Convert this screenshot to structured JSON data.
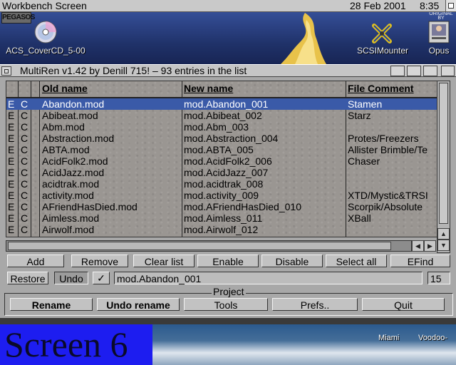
{
  "screen": {
    "title": "Workbench Screen",
    "date": "28 Feb 2001",
    "clock": "8:35"
  },
  "desktop_icons": [
    {
      "label": "ACS_CoverCD_5-00",
      "icon": "cd-disk-icon"
    },
    {
      "label": "SCSIMounter",
      "icon": "tool-icon"
    },
    {
      "label": "Opus",
      "icon": "opus-icon"
    }
  ],
  "logo_text": "PEGASOS",
  "badge_text": "ORIGINAL BY",
  "window": {
    "title": "MultiRen v1.42 by Denill 715! – 93 entries in the list"
  },
  "list": {
    "headers": [
      "Old name",
      "New name",
      "File Comment"
    ],
    "selected_index": 0,
    "rows": [
      {
        "f1": "E",
        "f2": "C",
        "old": "Abandon.mod",
        "new": "mod.Abandon_001",
        "comment": "Stamen"
      },
      {
        "f1": "E",
        "f2": "C",
        "old": "Abibeat.mod",
        "new": "mod.Abibeat_002",
        "comment": "Starz"
      },
      {
        "f1": "E",
        "f2": "C",
        "old": "Abm.mod",
        "new": "mod.Abm_003",
        "comment": ""
      },
      {
        "f1": "E",
        "f2": "C",
        "old": "Abstraction.mod",
        "new": "mod.Abstraction_004",
        "comment": "Protes/Freezers"
      },
      {
        "f1": "E",
        "f2": "C",
        "old": "ABTA.mod",
        "new": "mod.ABTA_005",
        "comment": "Allister Brimble/Te"
      },
      {
        "f1": "E",
        "f2": "C",
        "old": "AcidFolk2.mod",
        "new": "mod.AcidFolk2_006",
        "comment": "Chaser"
      },
      {
        "f1": "E",
        "f2": "C",
        "old": "AcidJazz.mod",
        "new": "mod.AcidJazz_007",
        "comment": ""
      },
      {
        "f1": "E",
        "f2": "C",
        "old": "acidtrak.mod",
        "new": "mod.acidtrak_008",
        "comment": ""
      },
      {
        "f1": "E",
        "f2": "C",
        "old": "activity.mod",
        "new": "mod.activity_009",
        "comment": "XTD/Mystic&TRSI"
      },
      {
        "f1": "E",
        "f2": "C",
        "old": "AFriendHasDied.mod",
        "new": "mod.AFriendHasDied_010",
        "comment": "Scorpik/Absolute"
      },
      {
        "f1": "E",
        "f2": "C",
        "old": "Aimless.mod",
        "new": "mod.Aimless_011",
        "comment": "XBall"
      },
      {
        "f1": "E",
        "f2": "C",
        "old": "Airwolf.mod",
        "new": "mod.Airwolf_012",
        "comment": ""
      }
    ]
  },
  "buttons_row1": [
    "Add",
    "Remove",
    "Clear list",
    "Enable",
    "Disable",
    "Select all",
    "EFind"
  ],
  "buttons_row2": {
    "restore": "Restore",
    "undo": "Undo",
    "check": "✓",
    "edit_value": "mod.Abandon_001",
    "number_value": "15"
  },
  "project": {
    "label": "Project",
    "buttons": [
      "Rename",
      "Undo rename",
      "Tools",
      "Prefs..",
      "Quit"
    ]
  },
  "bottom_bar": {
    "screen_label": "Screen 6",
    "icons": [
      "Miami",
      "Voodoo-"
    ]
  }
}
